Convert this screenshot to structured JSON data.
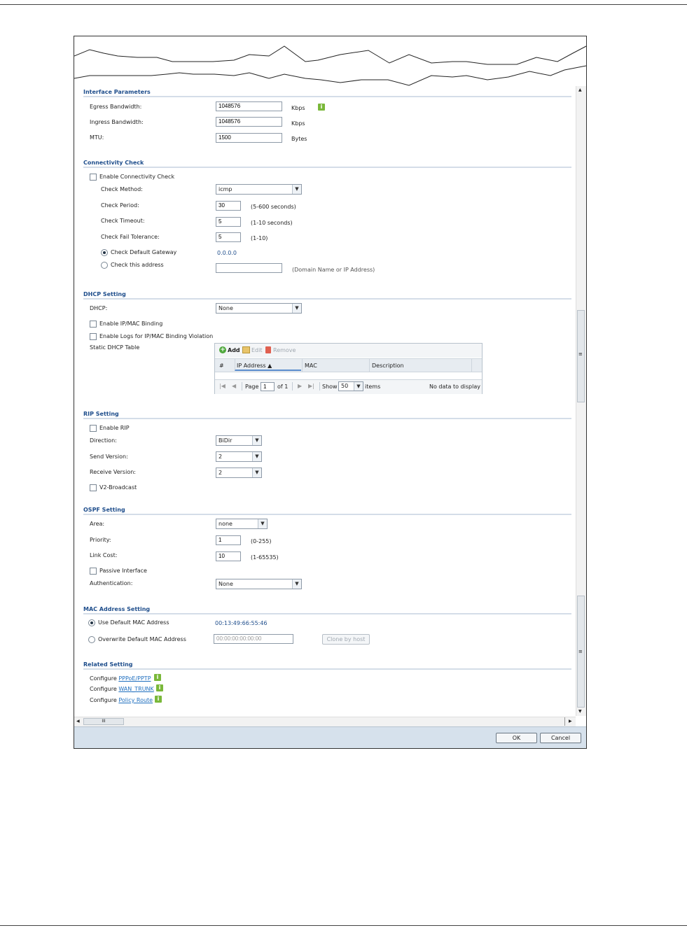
{
  "interface_parameters": {
    "title": "Interface Parameters",
    "egress_label": "Egress Bandwidth:",
    "egress_value": "1048576",
    "egress_unit": "Kbps",
    "ingress_label": "Ingress Bandwidth:",
    "ingress_value": "1048576",
    "ingress_unit": "Kbps",
    "mtu_label": "MTU:",
    "mtu_value": "1500",
    "mtu_unit": "Bytes"
  },
  "connectivity_check": {
    "title": "Connectivity Check",
    "enable_label": "Enable Connectivity Check",
    "method_label": "Check Method:",
    "method_value": "icmp",
    "period_label": "Check Period:",
    "period_value": "30",
    "period_hint": "(5-600 seconds)",
    "timeout_label": "Check Timeout:",
    "timeout_value": "5",
    "timeout_hint": "(1-10 seconds)",
    "fail_label": "Check Fail Tolerance:",
    "fail_value": "5",
    "fail_hint": "(1-10)",
    "default_gw_label": "Check Default Gateway",
    "default_gw_value": "0.0.0.0",
    "this_addr_label": "Check this address",
    "this_addr_value": "",
    "this_addr_hint": "(Domain Name or IP Address)"
  },
  "dhcp_setting": {
    "title": "DHCP Setting",
    "dhcp_label": "DHCP:",
    "dhcp_value": "None",
    "ipmac_label": "Enable IP/MAC Binding",
    "logs_label": "Enable Logs for IP/MAC Binding Violation",
    "static_label": "Static DHCP Table",
    "table": {
      "add": "Add",
      "edit": "Edit",
      "remove": "Remove",
      "columns": [
        "#",
        "IP Address ▲",
        "MAC",
        "Description"
      ],
      "page_label": "Page",
      "page_value": "1",
      "of_label": "of 1",
      "show_label": "Show",
      "show_value": "50",
      "items_label": "items",
      "empty": "No data to display"
    }
  },
  "rip_setting": {
    "title": "RIP Setting",
    "enable_label": "Enable RIP",
    "direction_label": "Direction:",
    "direction_value": "BiDir",
    "send_label": "Send Version:",
    "send_value": "2",
    "receive_label": "Receive Version:",
    "receive_value": "2",
    "v2_label": "V2-Broadcast"
  },
  "ospf_setting": {
    "title": "OSPF Setting",
    "area_label": "Area:",
    "area_value": "none",
    "priority_label": "Priority:",
    "priority_value": "1",
    "priority_hint": "(0-255)",
    "cost_label": "Link Cost:",
    "cost_value": "10",
    "cost_hint": "(1-65535)",
    "passive_label": "Passive Interface",
    "auth_label": "Authentication:",
    "auth_value": "None"
  },
  "mac_setting": {
    "title": "MAC Address Setting",
    "use_default_label": "Use Default MAC Address",
    "default_mac": "00:13:49:66:55:46",
    "overwrite_label": "Overwrite Default MAC Address",
    "overwrite_value": "00:00:00:00:00:00",
    "clone_label": "Clone by host"
  },
  "related_setting": {
    "title": "Related Setting",
    "configure": "Configure",
    "links": [
      "PPPoE/PPTP",
      "WAN_TRUNK",
      "Policy Route"
    ]
  },
  "footer": {
    "ok": "OK",
    "cancel": "Cancel"
  },
  "scrollbar": {
    "h_grip": "III",
    "v_grip": "≡"
  },
  "colors": {
    "section_title": "#1f4e8c",
    "info_icon": "#7ab83a",
    "footer_bar": "#d6e1ec"
  }
}
